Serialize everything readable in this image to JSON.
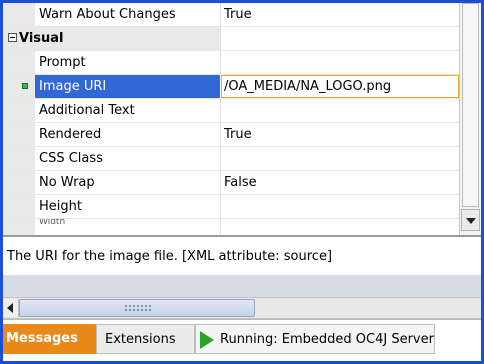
{
  "property_grid": {
    "rows": [
      {
        "name": "Warn About Changes",
        "value": "True"
      },
      {
        "category": "Visual"
      },
      {
        "name": "Prompt",
        "value": ""
      },
      {
        "name": "Image URI",
        "value": "/OA_MEDIA/NA_LOGO.png",
        "selected": true
      },
      {
        "name": "Additional Text",
        "value": ""
      },
      {
        "name": "Rendered",
        "value": "True"
      },
      {
        "name": "CSS Class",
        "value": ""
      },
      {
        "name": "No Wrap",
        "value": "False"
      },
      {
        "name": "Height",
        "value": ""
      },
      {
        "name": "Width",
        "value": "",
        "truncated": true
      }
    ]
  },
  "description": "The URI for the image file. [XML attribute: source]",
  "tabs": {
    "messages": "Messages",
    "extensions": "Extensions",
    "running": "Running: Embedded OC4J Server"
  },
  "colors": {
    "frame_border": "#1b4fd8",
    "selection": "#3168d5",
    "active_tab": "#e8891a",
    "run_icon": "#2aa52a"
  }
}
